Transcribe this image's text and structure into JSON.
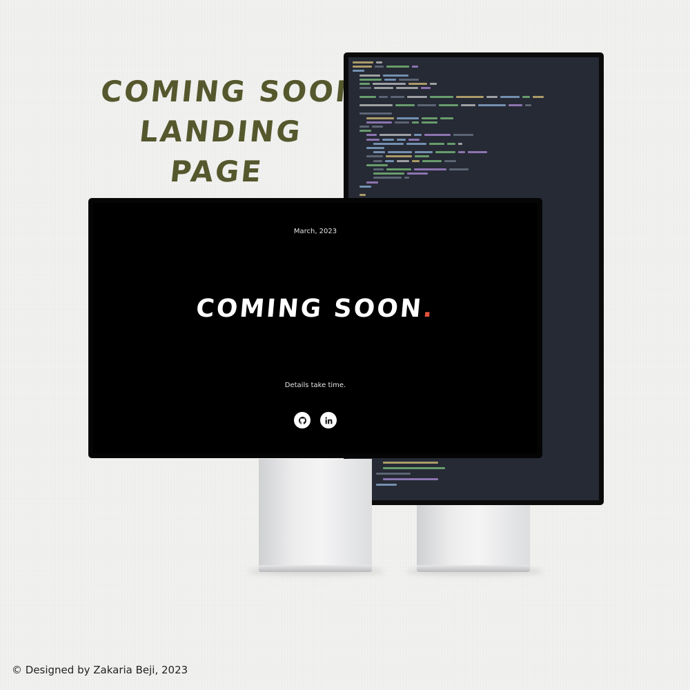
{
  "headline": {
    "line1": "COMING SOON",
    "line2": "LANDING",
    "line3": "PAGE"
  },
  "front_screen": {
    "date": "March, 2023",
    "title": "COMING SOON",
    "title_dot": ".",
    "tagline": "Details take time.",
    "social": [
      {
        "name": "github",
        "icon": "github-icon"
      },
      {
        "name": "linkedin",
        "icon": "linkedin-icon"
      }
    ]
  },
  "credit": "© Designed by Zakaria Beji, 2023",
  "colors": {
    "headline": "#55582d",
    "background": "#f2f2f0",
    "screen": "#000000",
    "code_background": "#262a35",
    "accent_dot": "#e0533a"
  }
}
